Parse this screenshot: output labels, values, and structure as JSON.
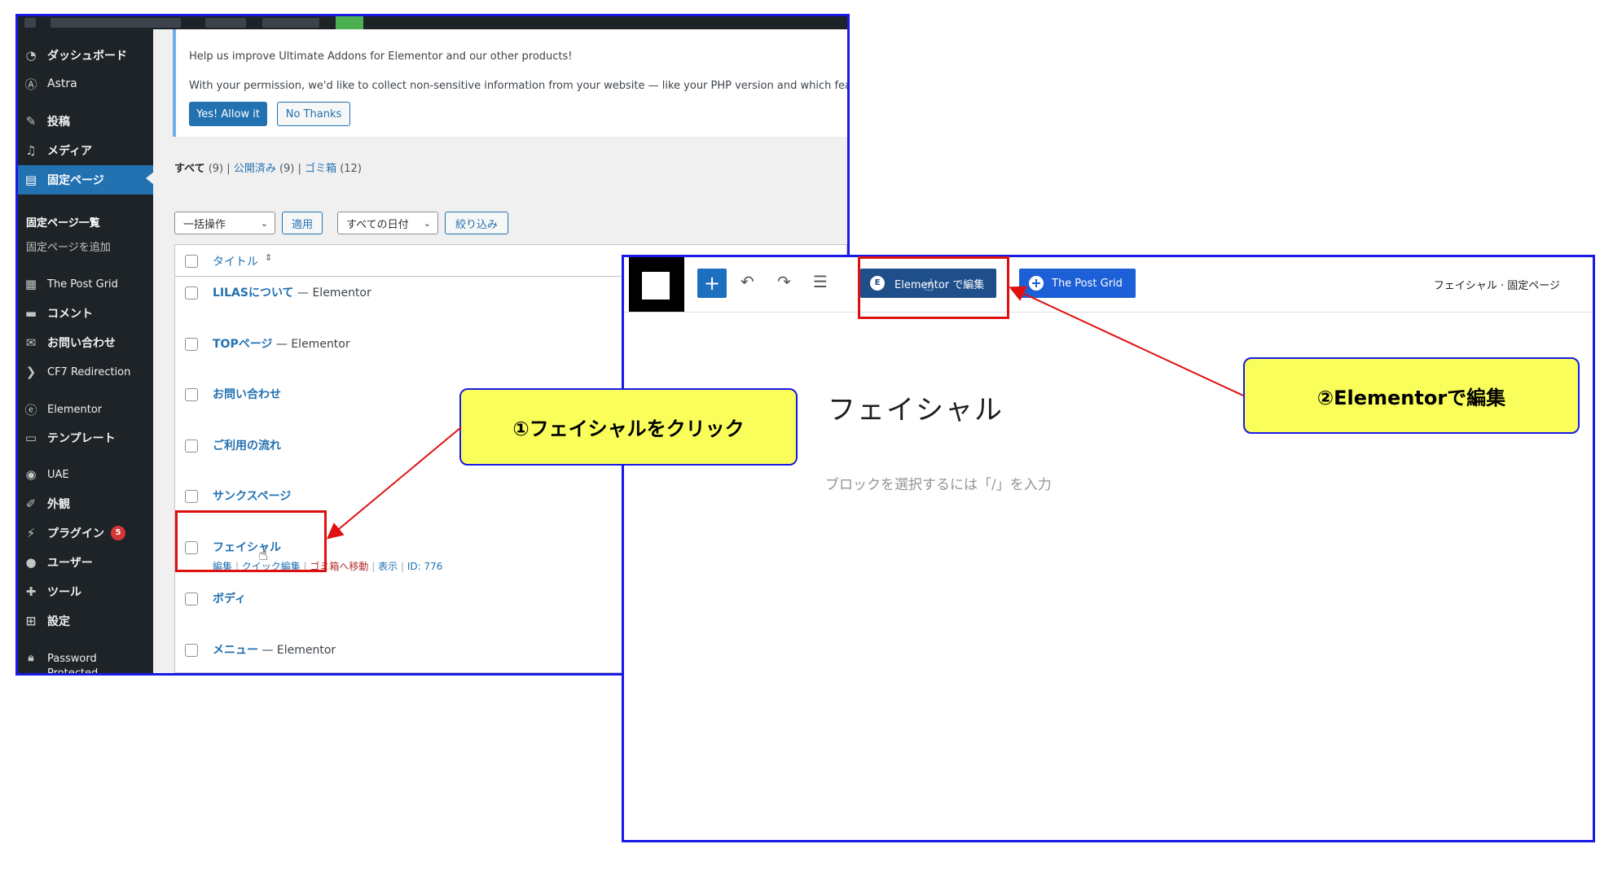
{
  "wp": {
    "notice": {
      "line1": "Help us improve Ultimate Addons for Elementor and our other products!",
      "line2": "With your permission, we'd like to collect non-sensitive information from your website — like your PHP version and which features yo",
      "allow": "Yes! Allow it",
      "no": "No Thanks"
    },
    "sidebar": {
      "items": [
        {
          "label": "ダッシュボード",
          "icon": "dashboard-icon"
        },
        {
          "label": "Astra",
          "icon": "astra-icon"
        },
        {
          "label": "投稿",
          "icon": "pin-icon"
        },
        {
          "label": "メディア",
          "icon": "media-icon"
        },
        {
          "label": "固定ページ",
          "icon": "page-icon"
        },
        {
          "label": "The Post Grid",
          "icon": "grid-icon"
        },
        {
          "label": "コメント",
          "icon": "comment-icon"
        },
        {
          "label": "お問い合わせ",
          "icon": "mail-icon"
        },
        {
          "label": "CF7 Redirection",
          "icon": "redirect-icon"
        },
        {
          "label": "Elementor",
          "icon": "elementor-icon"
        },
        {
          "label": "テンプレート",
          "icon": "folder-icon"
        },
        {
          "label": "UAE",
          "icon": "uae-icon"
        },
        {
          "label": "外観",
          "icon": "brush-icon"
        },
        {
          "label": "プラグイン",
          "icon": "plugin-icon"
        },
        {
          "label": "ユーザー",
          "icon": "user-icon"
        },
        {
          "label": "ツール",
          "icon": "wrench-icon"
        },
        {
          "label": "設定",
          "icon": "settings-icon"
        }
      ],
      "plugin_badge": "5",
      "submenu": [
        "固定ページ一覧",
        "固定ページを追加"
      ],
      "password_line1": "Password",
      "password_line2": "Protected"
    },
    "filters": {
      "all": "すべて",
      "all_count": "(9)",
      "published": "公開済み",
      "published_count": "(9)",
      "trash": "ゴミ箱",
      "trash_count": "(12)",
      "sep": "|"
    },
    "bulk": {
      "select": "一括操作",
      "apply": "適用",
      "date": "すべての日付",
      "filter": "絞り込み"
    },
    "table": {
      "header": "タイトル",
      "rows": [
        {
          "title": "LILASについて",
          "suffix": " — Elementor"
        },
        {
          "title": "TOPページ",
          "suffix": " — Elementor"
        },
        {
          "title": "お問い合わせ",
          "suffix": ""
        },
        {
          "title": "ご利用の流れ",
          "suffix": ""
        },
        {
          "title": "サンクスページ",
          "suffix": ""
        },
        {
          "title": "フェイシャル",
          "suffix": ""
        },
        {
          "title": "ボディ",
          "suffix": ""
        },
        {
          "title": "メニュー",
          "suffix": " — Elementor"
        }
      ],
      "actions": {
        "edit": "編集",
        "quick": "クイック編集",
        "trash": "ゴミ箱へ移動",
        "view": "表示",
        "id": "ID: 776"
      }
    }
  },
  "editor": {
    "elementor_button": "Elementor で編集",
    "postgrid_button": "The Post Grid",
    "breadcrumb": "フェイシャル · 固定ページ",
    "title": "フェイシャル",
    "placeholder": "ブロックを選択するには「/」を入力"
  },
  "callouts": {
    "step1": "①フェイシャルをクリック",
    "step2": "②Elementorで編集"
  },
  "colors": {
    "callout_bg": "#fafe5a",
    "frame": "#1a1ae6",
    "highlight": "#e01010",
    "wp_blue": "#2271b1"
  }
}
